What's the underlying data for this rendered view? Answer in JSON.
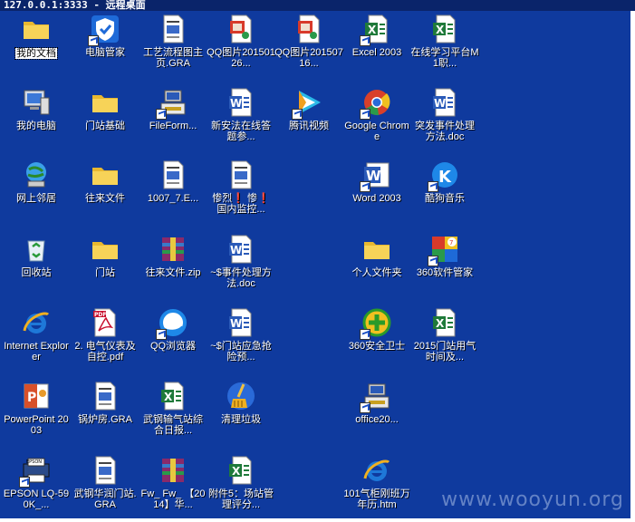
{
  "window": {
    "title": "127.0.0.1:3333 - 远程桌面"
  },
  "watermark": "www.wooyun.org",
  "columns": [
    [
      {
        "label": "我的文档",
        "icon": "folder-icon",
        "selected": true,
        "shortcut": false
      },
      {
        "label": "我的电脑",
        "icon": "computer-icon",
        "shortcut": false
      },
      {
        "label": "网上邻居",
        "icon": "network-icon",
        "shortcut": false
      },
      {
        "label": "回收站",
        "icon": "recycle-bin-icon",
        "shortcut": false
      },
      {
        "label": "Internet Explorer",
        "icon": "ie-icon",
        "shortcut": false
      },
      {
        "label": "PowerPoint 2003",
        "icon": "powerpoint-icon",
        "shortcut": false
      },
      {
        "label": "EPSON LQ-590K_...",
        "icon": "printer-icon",
        "shortcut": true
      }
    ],
    [
      {
        "label": "电脑管家",
        "icon": "shield-icon",
        "shortcut": true
      },
      {
        "label": "门站基础",
        "icon": "folder-icon",
        "shortcut": false
      },
      {
        "label": "往来文件",
        "icon": "folder-icon",
        "shortcut": false
      },
      {
        "label": "门站",
        "icon": "folder-icon",
        "shortcut": false
      },
      {
        "label": "2. 电气仪表及自控.pdf",
        "icon": "pdf-icon",
        "shortcut": false
      },
      {
        "label": "锅炉房.GRA",
        "icon": "doc-icon",
        "shortcut": false
      },
      {
        "label": "武钢华润门站.GRA",
        "icon": "doc-icon",
        "shortcut": false
      }
    ],
    [
      {
        "label": "工艺流程图主页.GRA",
        "icon": "doc-icon",
        "shortcut": false
      },
      {
        "label": "FileForm...",
        "icon": "installer-icon",
        "shortcut": true
      },
      {
        "label": "1007_7.E...",
        "icon": "doc-icon",
        "shortcut": false
      },
      {
        "label": "往来文件.zip",
        "icon": "archive-icon",
        "shortcut": false
      },
      {
        "label": "QQ浏览器",
        "icon": "qq-browser-icon",
        "shortcut": true
      },
      {
        "label": "武钢输气站综合日报...",
        "icon": "excel-icon",
        "shortcut": false
      },
      {
        "label": "Fw_ Fw_ 【2014】华...",
        "icon": "archive-icon",
        "shortcut": false
      }
    ],
    [
      {
        "label": "QQ图片20150126...",
        "icon": "image-icon",
        "shortcut": false
      },
      {
        "label": "新安法在线答题参...",
        "icon": "word-icon",
        "shortcut": false
      },
      {
        "label": "惨烈❗ 惨❗ 国内监控...",
        "icon": "doc-icon",
        "shortcut": false
      },
      {
        "label": "~$事件处理方法.doc",
        "icon": "word-icon",
        "shortcut": false
      },
      {
        "label": "~$门站应急抢险预...",
        "icon": "word-icon",
        "shortcut": false
      },
      {
        "label": "清理垃圾",
        "icon": "broom-icon",
        "shortcut": false
      },
      {
        "label": "附件5：场站管理评分...",
        "icon": "excel-icon",
        "shortcut": false
      }
    ],
    [
      {
        "label": "QQ图片20150716...",
        "icon": "image-icon",
        "shortcut": false
      },
      {
        "label": "腾讯视频",
        "icon": "video-icon",
        "shortcut": true
      },
      {
        "label": "",
        "icon": "",
        "shortcut": false
      },
      {
        "label": "",
        "icon": "",
        "shortcut": false
      },
      {
        "label": "",
        "icon": "",
        "shortcut": false
      },
      {
        "label": "",
        "icon": "",
        "shortcut": false
      },
      {
        "label": "",
        "icon": "",
        "shortcut": false
      }
    ],
    [
      {
        "label": "Excel 2003",
        "icon": "excel-icon",
        "shortcut": true
      },
      {
        "label": "Google Chrome",
        "icon": "chrome-icon",
        "shortcut": true
      },
      {
        "label": "Word 2003",
        "icon": "word-app-icon",
        "shortcut": true
      },
      {
        "label": "个人文件夹",
        "icon": "folder-icon",
        "shortcut": false
      },
      {
        "label": "360安全卫士",
        "icon": "security-360-icon",
        "shortcut": true
      },
      {
        "label": "office20...",
        "icon": "installer-icon",
        "shortcut": true
      },
      {
        "label": "101气柜刚班万年历.htm",
        "icon": "ie-icon",
        "shortcut": false
      }
    ],
    [
      {
        "label": "在线学习平台M1职...",
        "icon": "excel-icon",
        "shortcut": false
      },
      {
        "label": "突发事件处理方法.doc",
        "icon": "word-icon",
        "shortcut": false
      },
      {
        "label": "酷狗音乐",
        "icon": "kugou-icon",
        "shortcut": true
      },
      {
        "label": "360软件管家",
        "icon": "software-360-icon",
        "shortcut": true
      },
      {
        "label": "2015门站用气时间及...",
        "icon": "excel-icon",
        "shortcut": false
      },
      {
        "label": "",
        "icon": "",
        "shortcut": false
      },
      {
        "label": "",
        "icon": "",
        "shortcut": false
      }
    ]
  ]
}
